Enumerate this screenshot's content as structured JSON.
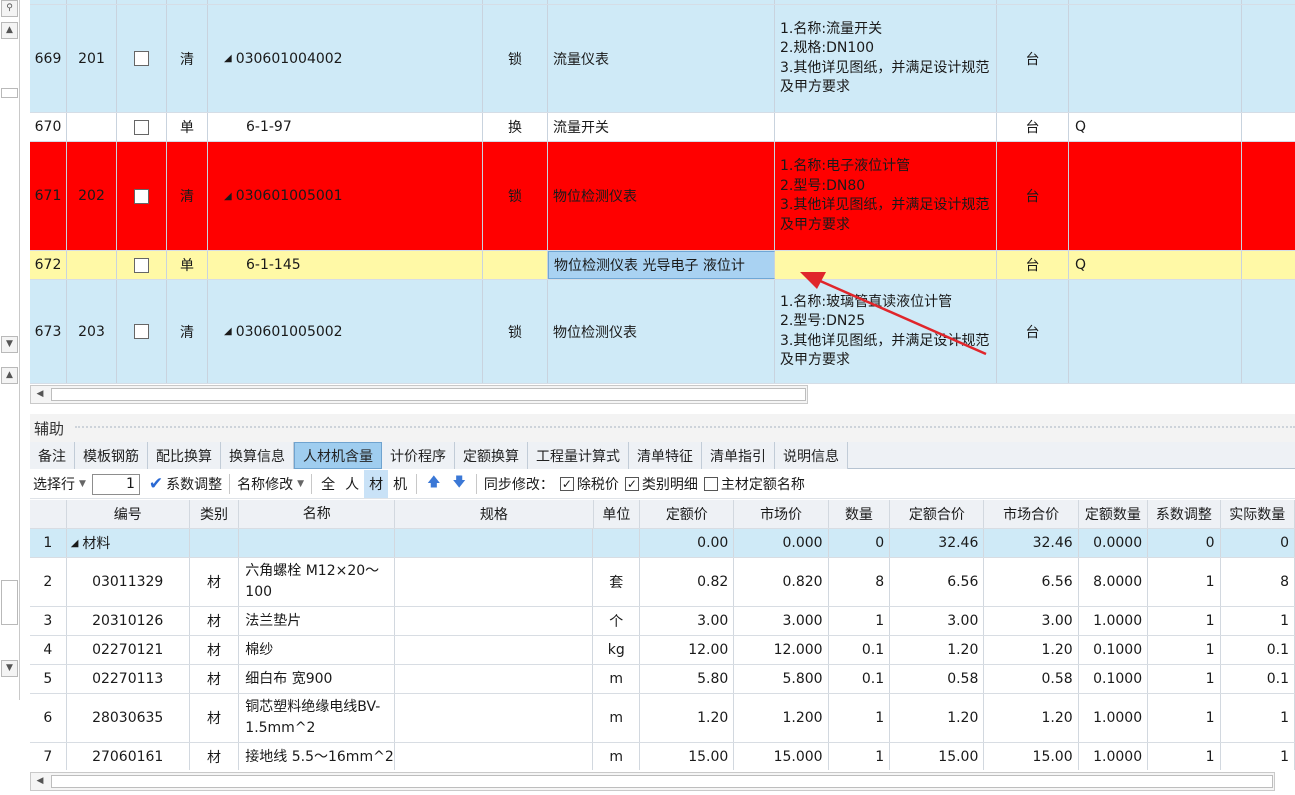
{
  "top_rows": [
    {
      "idx": "669",
      "num": "201",
      "type": "清",
      "code": "030601004002",
      "tri": true,
      "lock": "锁",
      "name": "流量仪表",
      "features": [
        "1.名称:流量开关",
        "2.规格:DN100",
        "3.其他详见图纸，并满足设计规范及甲方要求"
      ],
      "unit": "台",
      "q": "",
      "style": "blue"
    },
    {
      "idx": "670",
      "num": "",
      "type": "单",
      "code": "6-1-97",
      "tri": false,
      "lock": "换",
      "name": "流量开关",
      "features": [],
      "unit": "台",
      "q": "Q",
      "style": "white"
    },
    {
      "idx": "671",
      "num": "202",
      "type": "清",
      "code": "030601005001",
      "tri": true,
      "lock": "锁",
      "name": "物位检测仪表",
      "features": [
        "1.名称:电子液位计管",
        "2.型号:DN80",
        "3.其他详见图纸，并满足设计规范及甲方要求"
      ],
      "unit": "台",
      "q": "",
      "style": "red"
    },
    {
      "idx": "672",
      "num": "",
      "type": "单",
      "code": "6-1-145",
      "tri": false,
      "lock": "",
      "name": "物位检测仪表 光导电子 液位计",
      "features": [],
      "unit": "台",
      "q": "Q",
      "style": "yellow"
    },
    {
      "idx": "673",
      "num": "203",
      "type": "清",
      "code": "030601005002",
      "tri": true,
      "lock": "锁",
      "name": "物位检测仪表",
      "features": [
        "1.名称:玻璃管直读液位计管",
        "2.型号:DN25",
        "3.其他详见图纸，并满足设计规范及甲方要求"
      ],
      "unit": "台",
      "q": "",
      "style": "blue"
    }
  ],
  "aux": {
    "title": "辅助"
  },
  "tabs": [
    {
      "label": "备注",
      "active": false
    },
    {
      "label": "模板钢筋",
      "active": false
    },
    {
      "label": "配比换算",
      "active": false
    },
    {
      "label": "换算信息",
      "active": false
    },
    {
      "label": "人材机含量",
      "active": true
    },
    {
      "label": "计价程序",
      "active": false
    },
    {
      "label": "定额换算",
      "active": false
    },
    {
      "label": "工程量计算式",
      "active": false
    },
    {
      "label": "清单特征",
      "active": false
    },
    {
      "label": "清单指引",
      "active": false
    },
    {
      "label": "说明信息",
      "active": false
    }
  ],
  "toolbar": {
    "select_row": "选择行",
    "row_value": "1",
    "coef_adjust": "系数调整",
    "name_modify": "名称修改",
    "filters": [
      {
        "label": "全",
        "active": false
      },
      {
        "label": "人",
        "active": false
      },
      {
        "label": "材",
        "active": true
      },
      {
        "label": "机",
        "active": false
      }
    ],
    "sync_label": "同步修改：",
    "opt_tax": "除税价",
    "opt_category": "类别明细",
    "opt_main": "主材定额名称"
  },
  "bottom_table": {
    "headers": {
      "code": "编号",
      "cat": "类别",
      "name": "名称",
      "spec": "规格",
      "unit": "单位",
      "price": "定额价",
      "mprice": "市场价",
      "qty": "数量",
      "sum": "定额合价",
      "msum": "市场合价",
      "dq": "定额数量",
      "adj": "系数调整",
      "real": "实际数量"
    },
    "rows": [
      {
        "idx": "1",
        "code": "材料",
        "cat": "",
        "name": "",
        "spec": "",
        "unit": "",
        "price": "0.00",
        "mprice": "0.000",
        "qty": "0",
        "sum": "32.46",
        "msum": "32.46",
        "dq": "0.0000",
        "adj": "0",
        "real": "0",
        "group": true
      },
      {
        "idx": "2",
        "code": "03011329",
        "cat": "材",
        "name": "六角螺栓 M12×20～100",
        "spec": "",
        "unit": "套",
        "price": "0.82",
        "mprice": "0.820",
        "qty": "8",
        "sum": "6.56",
        "msum": "6.56",
        "dq": "8.0000",
        "adj": "1",
        "real": "8",
        "group": false
      },
      {
        "idx": "3",
        "code": "20310126",
        "cat": "材",
        "name": "法兰垫片",
        "spec": "",
        "unit": "个",
        "price": "3.00",
        "mprice": "3.000",
        "qty": "1",
        "sum": "3.00",
        "msum": "3.00",
        "dq": "1.0000",
        "adj": "1",
        "real": "1",
        "group": false
      },
      {
        "idx": "4",
        "code": "02270121",
        "cat": "材",
        "name": "棉纱",
        "spec": "",
        "unit": "kg",
        "price": "12.00",
        "mprice": "12.000",
        "qty": "0.1",
        "sum": "1.20",
        "msum": "1.20",
        "dq": "0.1000",
        "adj": "1",
        "real": "0.1",
        "group": false
      },
      {
        "idx": "5",
        "code": "02270113",
        "cat": "材",
        "name": "细白布 宽900",
        "spec": "",
        "unit": "m",
        "price": "5.80",
        "mprice": "5.800",
        "qty": "0.1",
        "sum": "0.58",
        "msum": "0.58",
        "dq": "0.1000",
        "adj": "1",
        "real": "0.1",
        "group": false
      },
      {
        "idx": "6",
        "code": "28030635",
        "cat": "材",
        "name": "铜芯塑料绝缘电线BV-1.5mm^2",
        "spec": "",
        "unit": "m",
        "price": "1.20",
        "mprice": "1.200",
        "qty": "1",
        "sum": "1.20",
        "msum": "1.20",
        "dq": "1.0000",
        "adj": "1",
        "real": "1",
        "group": false
      },
      {
        "idx": "7",
        "code": "27060161",
        "cat": "材",
        "name": "接地线 5.5～16mm^2",
        "spec": "",
        "unit": "m",
        "price": "15.00",
        "mprice": "15.000",
        "qty": "1",
        "sum": "15.00",
        "msum": "15.00",
        "dq": "1.0000",
        "adj": "1",
        "real": "1",
        "group": false
      }
    ]
  },
  "colors": {
    "blue_row": "#cfeaf7",
    "red_row": "#ff0000",
    "yellow_row": "#fff9a6",
    "selected": "#a9d2f2",
    "annotation": "#e0262b"
  }
}
